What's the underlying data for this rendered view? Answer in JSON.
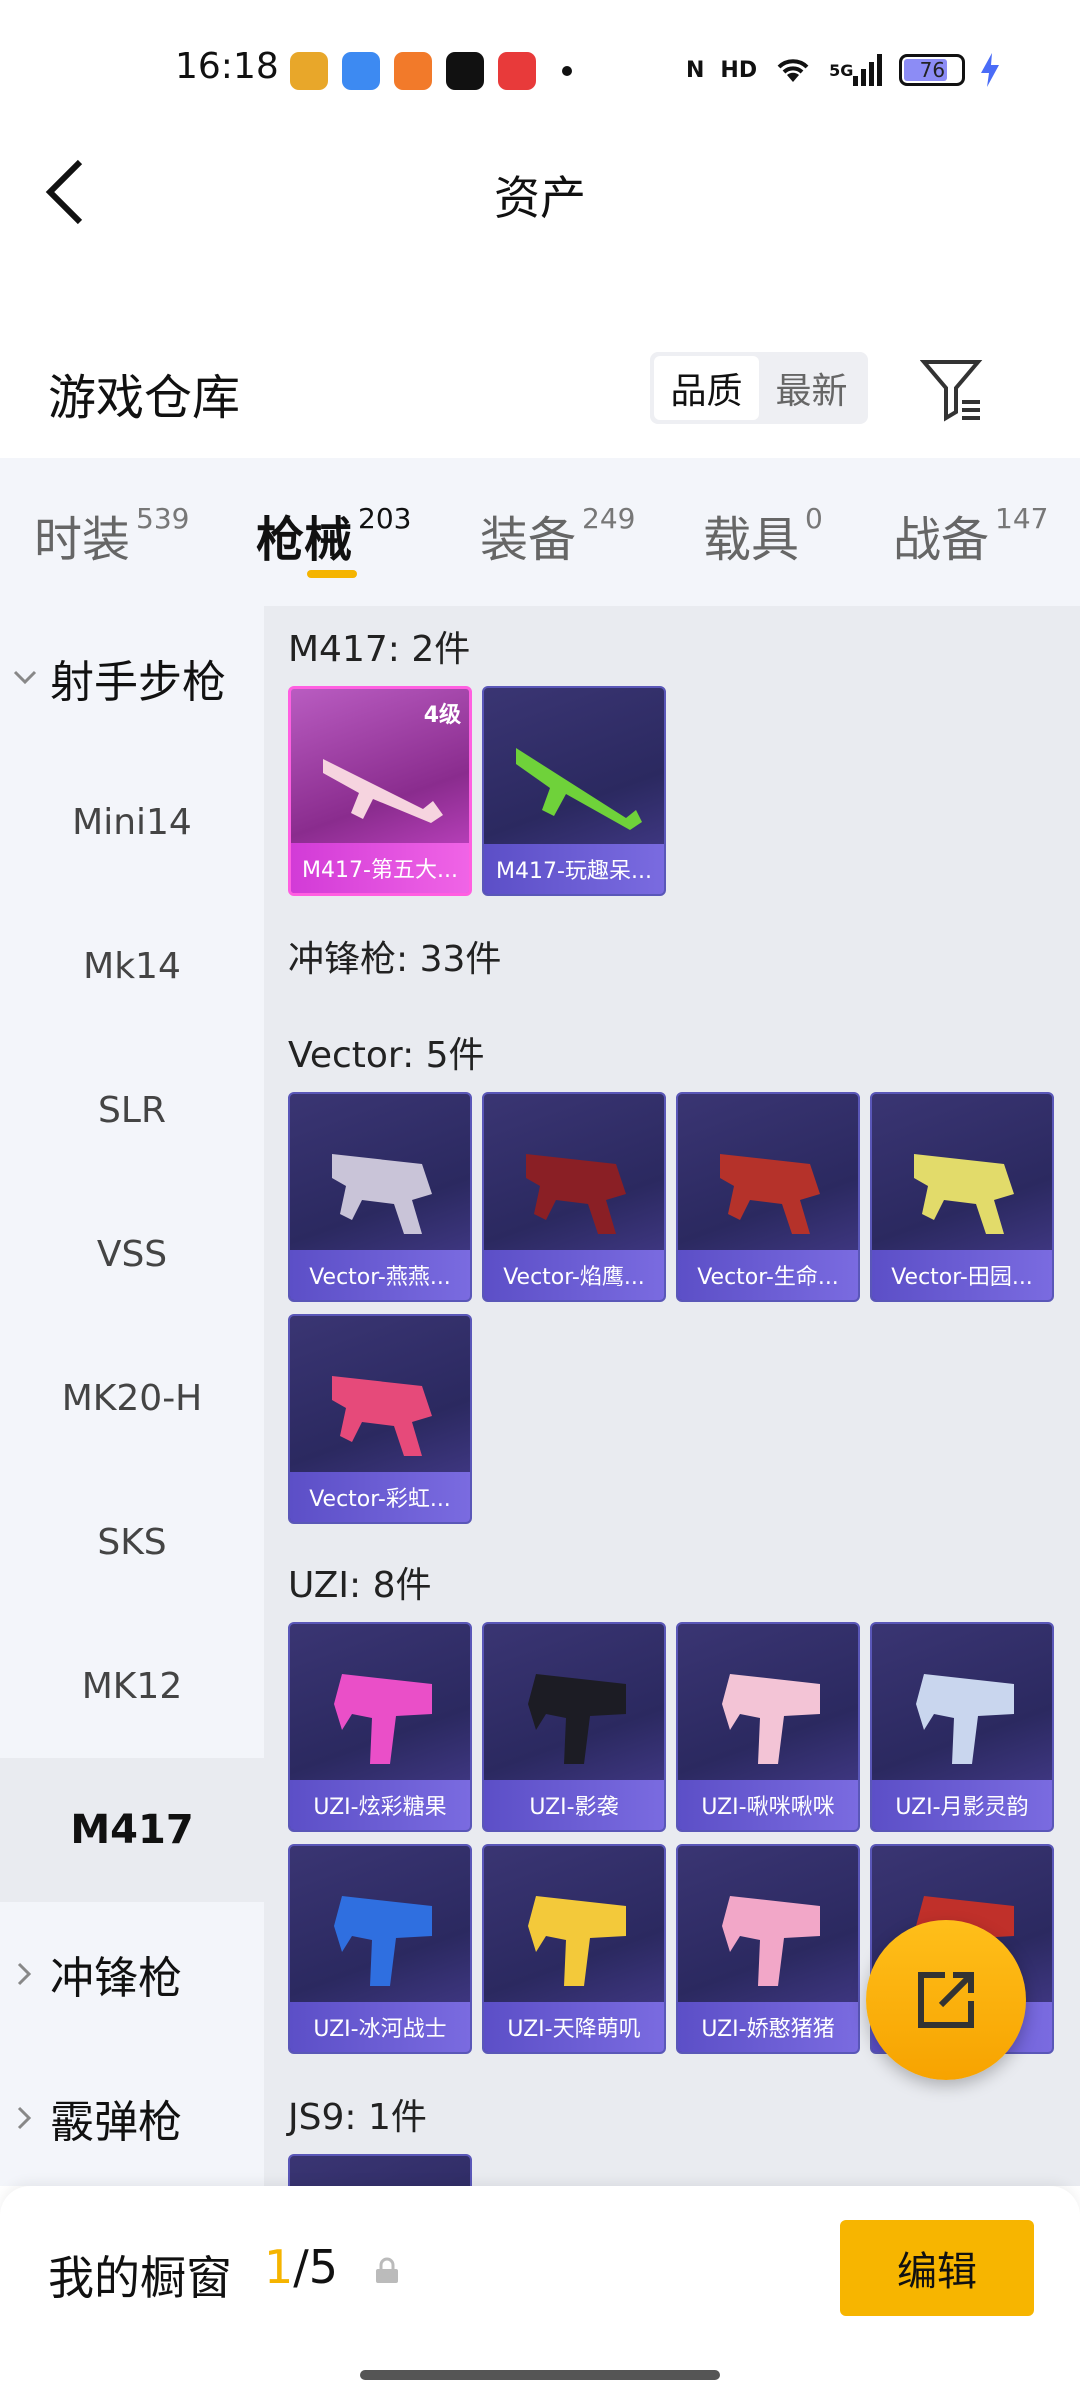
{
  "status_bar": {
    "time": "16:18",
    "battery": "76",
    "network": "5G"
  },
  "header": {
    "title": "资产"
  },
  "section": {
    "title": "游戏仓库",
    "sort_options": [
      "品质",
      "最新"
    ],
    "active_sort": "品质"
  },
  "tabs": [
    {
      "label": "时装",
      "count": "539"
    },
    {
      "label": "枪械",
      "count": "203"
    },
    {
      "label": "装备",
      "count": "249"
    },
    {
      "label": "载具",
      "count": "0"
    },
    {
      "label": "战备",
      "count": "147"
    }
  ],
  "sidebar": {
    "group_sniper": "射手步枪",
    "items": [
      "Mini14",
      "Mk14",
      "SLR",
      "VSS",
      "MK20-H",
      "SKS",
      "MK12",
      "M417"
    ],
    "group_smg": "冲锋枪",
    "group_shotgun": "霰弹枪"
  },
  "content": {
    "m417_title": "M417: 2件",
    "m417_cards": [
      {
        "label": "M417-第五大...",
        "level": "4级"
      },
      {
        "label": "M417-玩趣呆..."
      }
    ],
    "smg_title": "冲锋枪: 33件",
    "vector_title": "Vector: 5件",
    "vector_cards": [
      "Vector-燕燕...",
      "Vector-焰鹰...",
      "Vector-生命...",
      "Vector-田园...",
      "Vector-彩虹..."
    ],
    "uzi_title": "UZI: 8件",
    "uzi_cards": [
      "UZI-炫彩糖果",
      "UZI-影袭",
      "UZI-啾咪啾咪",
      "UZI-月影灵韵",
      "UZI-冰河战士",
      "UZI-天降萌叽",
      "UZI-娇憨猪猪",
      "UZI-..."
    ],
    "js9_title": "JS9: 1件"
  },
  "bottom": {
    "showcase_label": "我的橱窗",
    "showcase_current": "1",
    "showcase_total": "/5",
    "edit_label": "编辑"
  },
  "colors": {
    "accent": "#f5b400",
    "card_border": "#5a57b8",
    "legendary": "#ff5fe1"
  }
}
